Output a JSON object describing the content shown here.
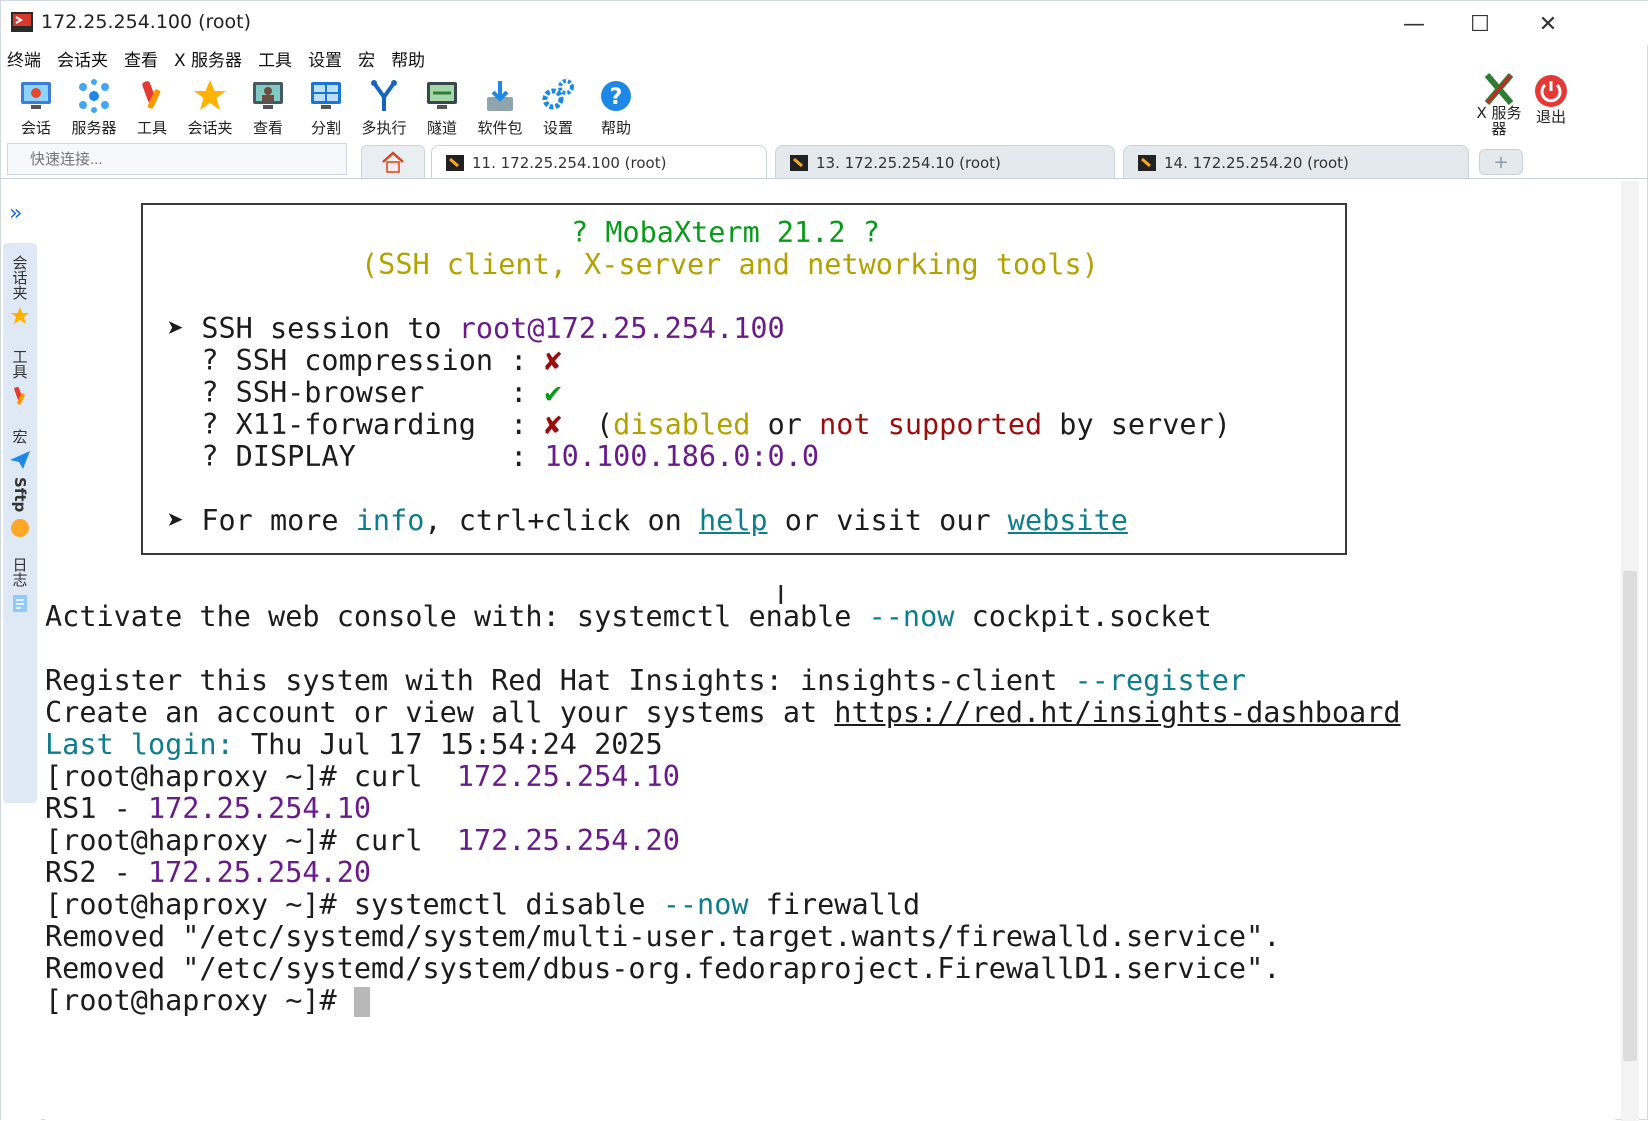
{
  "window": {
    "title": "172.25.254.100 (root)",
    "minimize": "—",
    "maximize": "☐",
    "close": "✕"
  },
  "menu": [
    "终端",
    "会话夹",
    "查看",
    "X 服务器",
    "工具",
    "设置",
    "宏",
    "帮助"
  ],
  "toolbar": [
    {
      "label": "会话",
      "icon": "session-monitor-icon"
    },
    {
      "label": "服务器",
      "icon": "servers-network-icon"
    },
    {
      "label": "工具",
      "icon": "tools-icon"
    },
    {
      "label": "会话夹",
      "icon": "star-icon"
    },
    {
      "label": "查看",
      "icon": "view-monitor-icon"
    },
    {
      "label": "分割",
      "icon": "split-icon"
    },
    {
      "label": "多执行",
      "icon": "multiexec-fork-icon"
    },
    {
      "label": "隧道",
      "icon": "tunnel-icon"
    },
    {
      "label": "软件包",
      "icon": "packages-download-icon"
    },
    {
      "label": "设置",
      "icon": "settings-gears-icon"
    },
    {
      "label": "帮助",
      "icon": "help-icon"
    }
  ],
  "toolbar_right": [
    {
      "label": "X 服务器",
      "icon": "x-server-icon"
    },
    {
      "label": "退出",
      "icon": "power-icon"
    }
  ],
  "quick_connect": {
    "placeholder": "快速连接..."
  },
  "tabs": [
    {
      "label": "11. 172.25.254.100 (root)",
      "active": true
    },
    {
      "label": "13. 172.25.254.10 (root)",
      "active": false
    },
    {
      "label": "14. 172.25.254.20 (root)",
      "active": false
    }
  ],
  "sidebar": {
    "tabs": [
      "会话夹",
      "工具",
      "宏",
      "Sftp",
      "日志"
    ]
  },
  "terminal": {
    "banner": {
      "title": "? MobaXterm 21.2 ?",
      "subtitle": "(SSH client, X-server and networking tools)",
      "session_prefix": "➤ SSH session to ",
      "session_user": "root",
      "session_host": "@172.25.254.100",
      "compression_label": "  ? SSH compression : ",
      "compression_value": "✘",
      "browser_label": "  ? SSH-browser     : ",
      "browser_value": "✔",
      "x11_label": "  ? X11-forwarding  : ",
      "x11_value": "✘",
      "x11_note_open": "  (",
      "x11_disabled": "disabled",
      "x11_or": " or ",
      "x11_not_supported": "not supported",
      "x11_note_close": " by server)",
      "display_label": "  ? DISPLAY         : ",
      "display_value": "10.100.186.0:0.0",
      "more_prefix": "➤ For more ",
      "more_info": "info",
      "more_mid": ", ctrl+click on ",
      "more_help": "help",
      "more_or": " or visit our ",
      "more_website": "website"
    },
    "lines": {
      "cockpit_a": "Activate the web console with: systemctl enable ",
      "cockpit_b": "--now",
      "cockpit_c": " cockpit.socket",
      "register_a": "Register this system with Red Hat Insights: insights-client ",
      "register_b": "--register",
      "account_a": "Create an account or view all your systems at ",
      "account_b": "https://red.ht/insights-dashboard",
      "lastlogin_a": "Last login:",
      "lastlogin_b": " Thu Jul 17 15:54:24 2025",
      "cmd1_a": "[root@haproxy ~]# curl  ",
      "cmd1_b": "172.25.254.10",
      "out1_a": "RS1 - ",
      "out1_b": "172.25.254.10",
      "cmd2_a": "[root@haproxy ~]# curl  ",
      "cmd2_b": "172.25.254.20",
      "out2_a": "RS2 - ",
      "out2_b": "172.25.254.20",
      "cmd3_a": "[root@haproxy ~]# systemctl disable ",
      "cmd3_b": "--now",
      "cmd3_c": " firewalld",
      "removed1": "Removed \"/etc/systemd/system/multi-user.target.wants/firewalld.service\".",
      "removed2": "Removed \"/etc/systemd/system/dbus-org.fedoraproject.FirewallD1.service\".",
      "prompt": "[root@haproxy ~]# "
    }
  },
  "colors": {
    "green": "#0a9a1a",
    "yellow": "#b3a100",
    "purple": "#6a1b8a",
    "darkred": "#9a0d0d",
    "teal": "#0f7d8c"
  }
}
